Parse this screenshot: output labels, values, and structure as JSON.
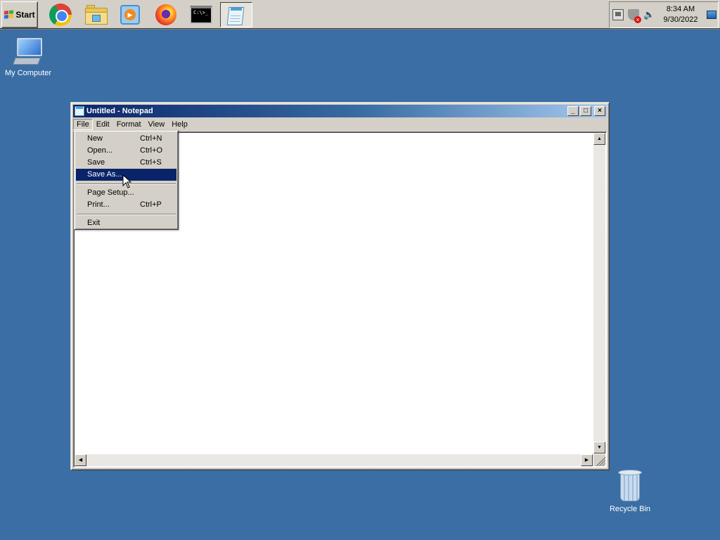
{
  "taskbar": {
    "start_label": "Start",
    "apps": [
      {
        "name": "Google Chrome",
        "icon": "chrome-icon"
      },
      {
        "name": "Windows Explorer",
        "icon": "folder-icon"
      },
      {
        "name": "Windows Media Player",
        "icon": "media-player-icon"
      },
      {
        "name": "Firefox",
        "icon": "firefox-icon"
      },
      {
        "name": "Command Prompt",
        "icon": "cmd-icon",
        "glyph": "C:\\>_"
      },
      {
        "name": "Notepad",
        "icon": "notepad-icon",
        "active": true
      }
    ],
    "clock": {
      "time": "8:34 AM",
      "date": "9/30/2022"
    }
  },
  "desktop": {
    "my_computer": "My Computer",
    "recycle_bin": "Recycle Bin"
  },
  "notepad": {
    "title": "Untitled - Notepad",
    "caption_buttons": {
      "minimize": "_",
      "maximize": "□",
      "close": "×"
    },
    "menu": [
      "File",
      "Edit",
      "Format",
      "View",
      "Help"
    ],
    "open_menu": "File",
    "text": ""
  },
  "file_menu": {
    "new": {
      "label": "New",
      "shortcut": "Ctrl+N"
    },
    "open": {
      "label": "Open...",
      "shortcut": "Ctrl+O"
    },
    "save": {
      "label": "Save",
      "shortcut": "Ctrl+S"
    },
    "save_as": {
      "label": "Save As...",
      "shortcut": "",
      "highlighted": true
    },
    "page_setup": {
      "label": "Page Setup...",
      "shortcut": ""
    },
    "print": {
      "label": "Print...",
      "shortcut": "Ctrl+P"
    },
    "exit": {
      "label": "Exit",
      "shortcut": ""
    }
  },
  "colors": {
    "desktop": "#3a6ea5",
    "title_active": "#0a246a",
    "menu_highlight": "#0a246a",
    "chrome_face": "#d4d0c8"
  }
}
